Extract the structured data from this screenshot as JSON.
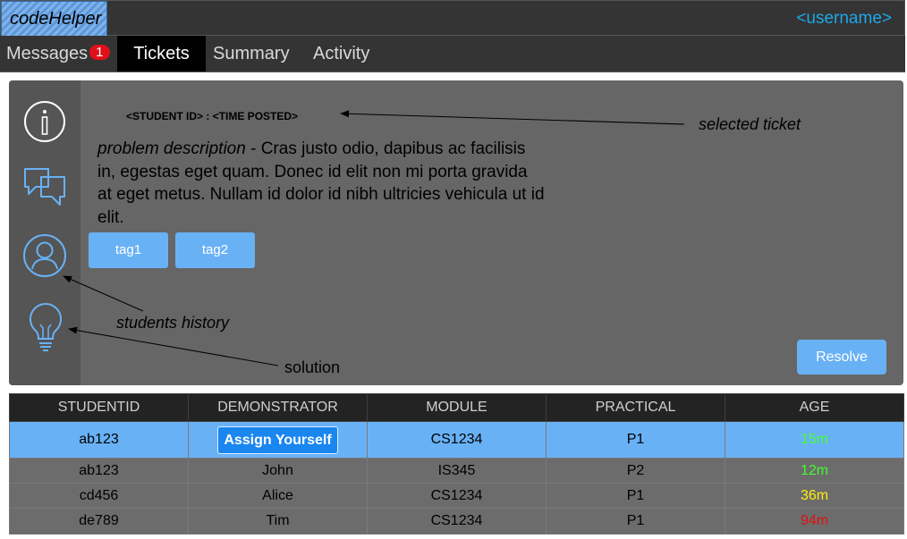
{
  "app": {
    "name": "codeHelper",
    "username": "<username>"
  },
  "nav": {
    "tabs": [
      {
        "label": "Messages",
        "badge": "1"
      },
      {
        "label": "Tickets"
      },
      {
        "label": "Summary"
      },
      {
        "label": "Activity"
      }
    ],
    "active": "Tickets"
  },
  "ticket": {
    "header": "<STUDENT ID> : <TIME POSTED>",
    "description_label": "problem description",
    "description_text": " - Cras justo odio, dapibus ac facilisis in, egestas eget quam. Donec id elit non mi porta gravida at eget metus. Nullam id dolor id nibh ultricies vehicula ut id elit.",
    "tags": [
      "tag1",
      "tag2"
    ],
    "resolve_label": "Resolve"
  },
  "sidebar": {
    "icons": [
      "info-icon",
      "chat-icon",
      "user-icon",
      "lightbulb-icon"
    ]
  },
  "annotations": {
    "selected_ticket": "selected ticket",
    "students_history": "students history",
    "solution": "solution"
  },
  "table": {
    "columns": [
      "STUDENTID",
      "DEMONSTRATOR",
      "MODULE",
      "PRACTICAL",
      "AGE"
    ],
    "rows": [
      {
        "studentid": "ab123",
        "demonstrator": "Assign Yourself",
        "module": "CS1234",
        "practical": "P1",
        "age": "15m",
        "age_color": "#44ff2f",
        "selected": true
      },
      {
        "studentid": "ab123",
        "demonstrator": "John",
        "module": "IS345",
        "practical": "P2",
        "age": "12m",
        "age_color": "#44ff2f"
      },
      {
        "studentid": "cd456",
        "demonstrator": "Alice",
        "module": "CS1234",
        "practical": "P1",
        "age": "36m",
        "age_color": "#ffee10"
      },
      {
        "studentid": "de789",
        "demonstrator": "Tim",
        "module": "CS1234",
        "practical": "P1",
        "age": "94m",
        "age_color": "#e01010"
      }
    ]
  },
  "colors": {
    "accent": "#69b1f5",
    "button_blue": "#1a86f0",
    "username": "#1ea8e8",
    "badge": "#e0101a"
  }
}
